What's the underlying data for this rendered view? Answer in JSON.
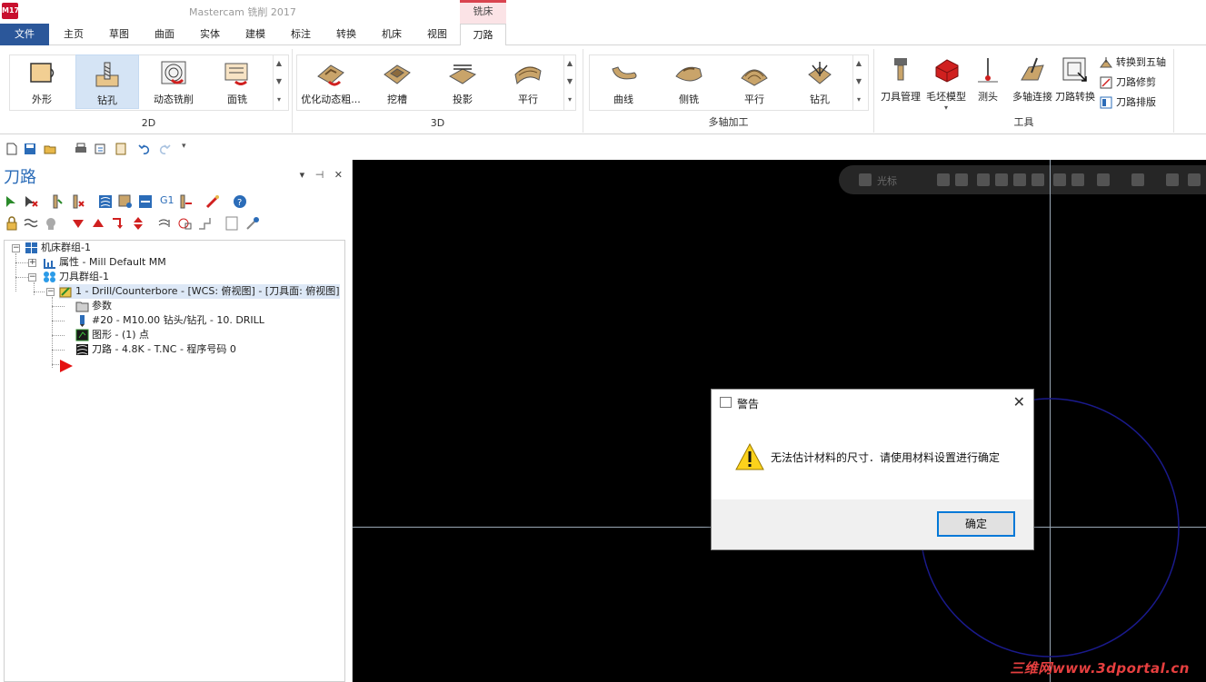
{
  "titlebar": {
    "logo": "M17",
    "title": "Mastercam 铣削 2017",
    "context_tab": "铣床"
  },
  "tabs": [
    "文件",
    "主页",
    "草图",
    "曲面",
    "实体",
    "建模",
    "标注",
    "转换",
    "机床",
    "视图",
    "刀路"
  ],
  "ribbon": {
    "group_2d": {
      "label": "2D",
      "buttons": [
        "外形",
        "钻孔",
        "动态铣削",
        "面铣"
      ]
    },
    "group_3d": {
      "label": "3D",
      "buttons": [
        "优化动态粗...",
        "挖槽",
        "投影",
        "平行"
      ]
    },
    "group_multi": {
      "label": "多轴加工",
      "buttons": [
        "曲线",
        "侧铣",
        "平行",
        "钻孔"
      ]
    },
    "group_tools": {
      "label": "工具",
      "buttons": [
        "刀具管理",
        "毛坯模型",
        "测头",
        "多轴连接",
        "刀路转换"
      ],
      "small_buttons": [
        "转换到五轴",
        "刀路修剪",
        "刀路排版"
      ]
    },
    "gallery_arrows": [
      "▲",
      "▼",
      "▾"
    ],
    "dropdown_marker": "▾"
  },
  "panel": {
    "title": "刀路",
    "controls": [
      "▾",
      "⊣",
      "✕"
    ],
    "tree": {
      "machine_group": "机床群组-1",
      "properties": "属性 - Mill Default MM",
      "tool_group": "刀具群组-1",
      "operation": "1 - Drill/Counterbore - [WCS: 俯视图] - [刀具面: 俯视图]",
      "params": "参数",
      "tool": "#20 - M10.00 钻头/钻孔 -     10. DRILL",
      "geometry": "图形 -  (1) 点",
      "toolpath": "刀路 - 4.8K - T.NC - 程序号码 0"
    },
    "expanders": [
      "−",
      "+",
      "−",
      "−"
    ],
    "g1_label": "G1"
  },
  "viewport": {
    "toolbar_label": "光标"
  },
  "dialog": {
    "title": "警告",
    "close": "✕",
    "message": "无法估计材料的尺寸．请使用材料设置进行确定",
    "ok_label": "确定"
  },
  "watermark": "三维网www.3dportal.cn",
  "colors": {
    "file_tab": "#2b579a",
    "context_accent": "#d9434f",
    "panel_title": "#2b6cb8",
    "viewport_bg": "#000000",
    "circle": "#1a1a8c"
  }
}
